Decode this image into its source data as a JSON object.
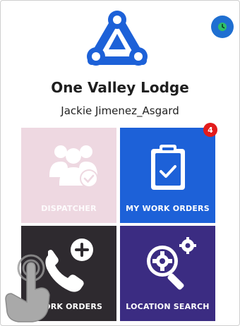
{
  "header": {
    "org_name": "One Valley Lodge",
    "user_name": "Jackie Jimenez_Asgard"
  },
  "status": {
    "icon": "clock-icon",
    "color": "#1f6fd1"
  },
  "brand": {
    "logo_icon": "triangle-nodes-logo",
    "color": "#1d61d8"
  },
  "tiles": [
    {
      "label": "DISPATCHER",
      "icon": "group-check-icon",
      "color": "#eed8e1",
      "disabled": true
    },
    {
      "label": "MY WORK ORDERS",
      "icon": "clipboard-check-icon",
      "color": "#1d61d8",
      "badge": "4"
    },
    {
      "label": "WORK ORDERS",
      "icon": "phone-add-icon",
      "color": "#2e2a2f"
    },
    {
      "label": "LOCATION SEARCH",
      "icon": "gear-search-icon",
      "color": "#3b2c82"
    }
  ],
  "overlay": {
    "icon": "tap-hand-icon"
  }
}
